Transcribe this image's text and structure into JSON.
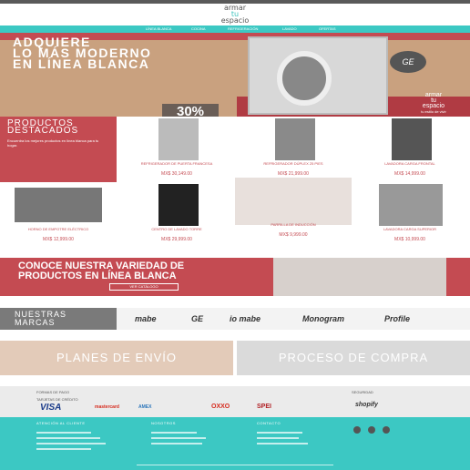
{
  "topbar": {
    "left": "· · · · ·"
  },
  "logo": {
    "line1": "armar",
    "line2": "tu",
    "line3": "espacio"
  },
  "nav": [
    "LÍNEA BLANCA",
    "COCINA",
    "REFRIGERACIÓN",
    "LAVADO",
    "OFERTAS"
  ],
  "hero": {
    "title_l1": "ADQUIERE",
    "title_l2": "LO MÁS MODERNO",
    "title_l3": "EN LÍNEA BLANCA",
    "discount": "30%",
    "brand_badge": "GE",
    "logo_l1": "armar",
    "logo_l2": "tu",
    "logo_l3": "espacio",
    "tagline": "tu estilo de vivir"
  },
  "featured": {
    "title_l1": "PRODUCTOS",
    "title_l2": "DESTACADOS",
    "desc": "Encuentra los mejores productos en línea blanca para tu hogar."
  },
  "products": [
    {
      "name": "REFRIGERADOR DE PUERTA FRANCESA",
      "price": "MX$ 30,149.00"
    },
    {
      "name": "REFRIGERADOR DÚPLEX 25 PIES",
      "price": "MX$ 21,999.00"
    },
    {
      "name": "LAVADORA CARGA FRONTAL",
      "price": "MX$ 14,999.00"
    },
    {
      "name": "HORNO DE EMPOTRE ELÉCTRICO",
      "price": "MX$ 12,999.00"
    },
    {
      "name": "CENTRO DE LAVADO TORRE",
      "price": "MX$ 29,999.00"
    },
    {
      "name": "PARRILLA DE INDUCCIÓN",
      "price": "MX$ 9,999.00"
    },
    {
      "name": "LAVADORA CARGA SUPERIOR",
      "price": "MX$ 10,999.00"
    }
  ],
  "banner2": {
    "l1": "CONOCE NUESTRA VARIEDAD DE",
    "l2": "PRODUCTOS EN LÍNEA BLANCA",
    "btn": "VER CATÁLOGO"
  },
  "brands": {
    "label_l1": "NUESTRAS",
    "label_l2": "MARCAS",
    "items": [
      "mabe",
      "GE",
      "io mabe",
      "Monogram",
      "Profile"
    ]
  },
  "panels": {
    "left": "PLANES DE ENVÍO",
    "right": "PROCESO DE COMPRA"
  },
  "payment": {
    "title": "FORMAS DE PAGO",
    "cards_label": "TARJETAS DE CRÉDITO",
    "cards": [
      "VISA",
      "mastercard",
      "AMEX",
      "OXXO",
      "SPEI"
    ],
    "secure_label": "SEGURIDAD",
    "secure": "shopify"
  },
  "footer": {
    "cols": [
      "ATENCIÓN AL CLIENTE",
      "NOSOTROS",
      "CONTACTO"
    ]
  },
  "colors": {
    "teal": "#3cc8c3",
    "red": "#c44b52",
    "tan": "#c9a17f"
  }
}
